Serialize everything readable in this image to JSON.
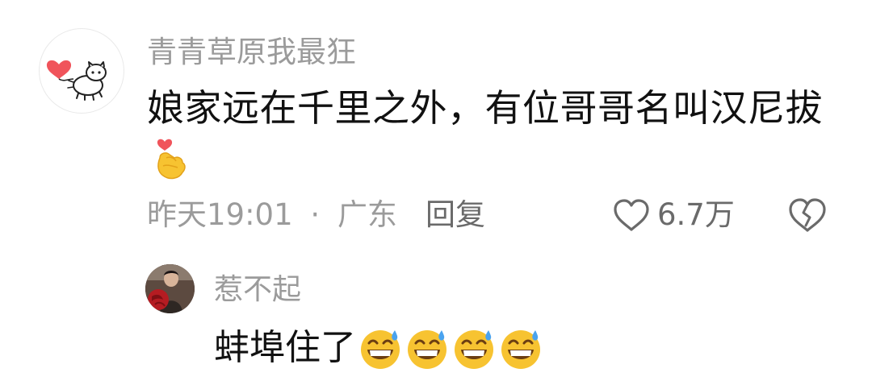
{
  "comment": {
    "username": "青青草原我最狂",
    "content": "娘家远在千里之外，有位哥哥名叫汉尼拔",
    "content_emoji": "finger-heart-emoji",
    "time": "昨天19:01",
    "separator": "·",
    "location": "广东",
    "reply_label": "回复",
    "like_count": "6.7万",
    "avatar": "cartoon-dog-with-heart-balloon"
  },
  "reply": {
    "username": "惹不起",
    "content": "蚌埠住了",
    "emojis": [
      "grinning-sweat-emoji",
      "grinning-sweat-emoji",
      "grinning-sweat-emoji",
      "grinning-sweat-emoji"
    ],
    "avatar": "person-with-red-rose"
  },
  "colors": {
    "secondary_text": "#9b9b9b",
    "primary_text": "#111111",
    "icon_gray": "#6a6a6a",
    "emoji_yellow": "#f7c331",
    "heart_red": "#f0545b"
  }
}
